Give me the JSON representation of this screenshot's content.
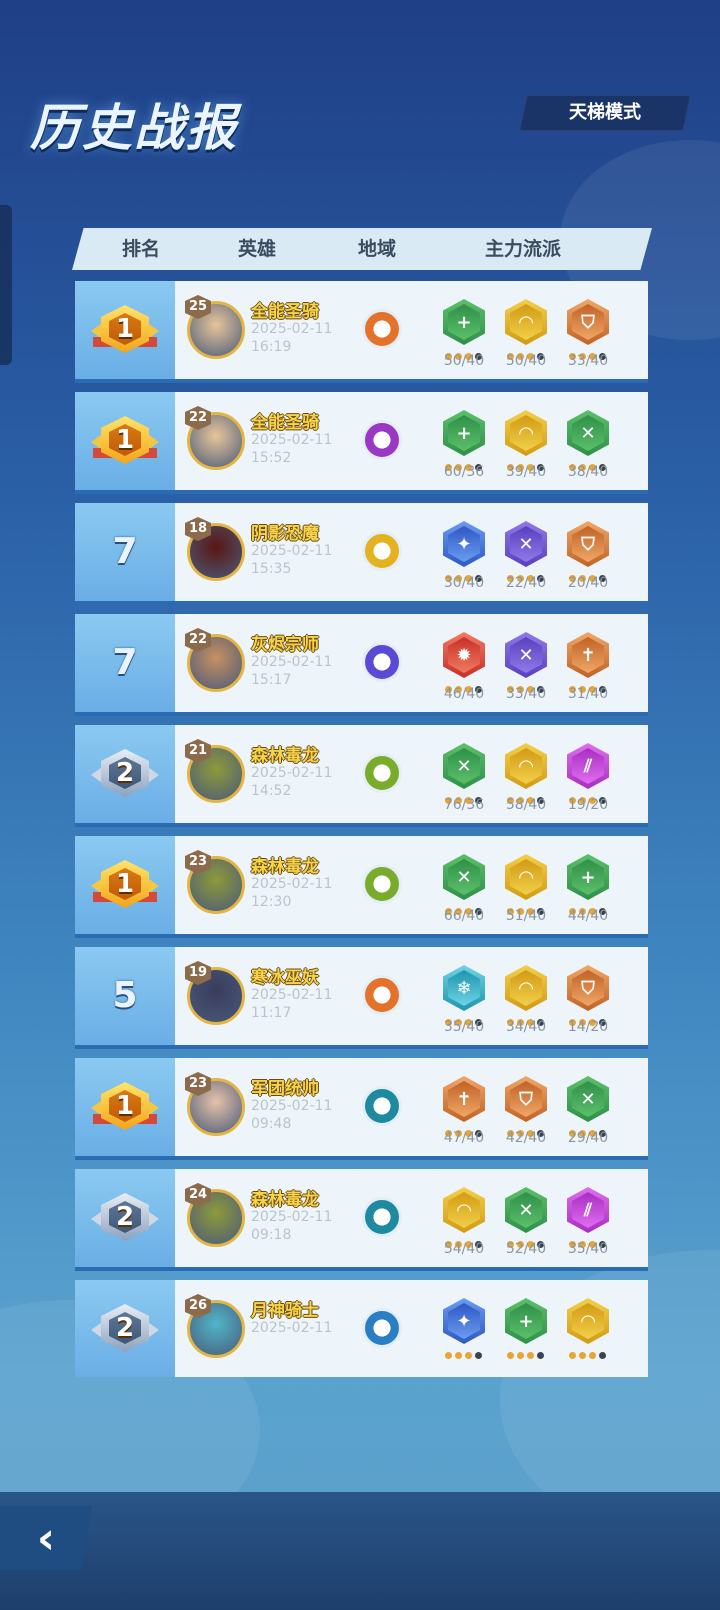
{
  "title": "历史战报",
  "mode_badge": "天梯模式",
  "columns": [
    "排名",
    "英雄",
    "地域",
    "主力流派"
  ],
  "colors": {
    "gold": "#f5d34a",
    "row_bg": "#eef5fa",
    "rank_bg": "#7cbcec",
    "green": "#3ea35a",
    "yellow": "#e6b521",
    "bronze": "#c8763a",
    "blue": "#3a6fd6",
    "purple": "#6c55c8",
    "red": "#d8463e",
    "magenta": "#c23ad0",
    "cyan": "#2ab0c4"
  },
  "matches": [
    {
      "rank": "1",
      "rank_style": "gold",
      "level": "25",
      "hero": "全能圣骑",
      "date": "2025-02-11",
      "time": "16:19",
      "region_icon": "axe-emblem-icon",
      "region_color": "#e4722a",
      "portrait_color": "#e7c69a",
      "stats": [
        {
          "icon": "plus-icon",
          "color": "green",
          "glyph": "+",
          "value": "50/40"
        },
        {
          "icon": "arm-icon",
          "color": "yellow",
          "glyph": "◠",
          "value": "50/40"
        },
        {
          "icon": "shield-icon",
          "color": "bronze",
          "glyph": "⛉",
          "value": "33/40"
        }
      ]
    },
    {
      "rank": "1",
      "rank_style": "gold",
      "level": "22",
      "hero": "全能圣骑",
      "date": "2025-02-11",
      "time": "15:52",
      "region_icon": "gears-icon",
      "region_color": "#9a37c4",
      "portrait_color": "#e7c69a",
      "stats": [
        {
          "icon": "plus-icon",
          "color": "green",
          "glyph": "+",
          "value": "60/36"
        },
        {
          "icon": "arm-icon",
          "color": "yellow",
          "glyph": "◠",
          "value": "39/40"
        },
        {
          "icon": "potion-icon",
          "color": "green",
          "glyph": "✕",
          "value": "38/40"
        }
      ]
    },
    {
      "rank": "7",
      "rank_style": "plain",
      "level": "18",
      "hero": "阴影恐魔",
      "date": "2025-02-11",
      "time": "15:35",
      "region_icon": "swirl-icon",
      "region_color": "#e4b21e",
      "portrait_color": "#5a1712",
      "stats": [
        {
          "icon": "sparkle-icon",
          "color": "blue",
          "glyph": "✦",
          "value": "30/40"
        },
        {
          "icon": "crossed-tools-icon",
          "color": "purple",
          "glyph": "✕",
          "value": "22/40"
        },
        {
          "icon": "shield-icon",
          "color": "bronze",
          "glyph": "⛉",
          "value": "20/40"
        }
      ]
    },
    {
      "rank": "7",
      "rank_style": "plain",
      "level": "22",
      "hero": "灰烬宗师",
      "date": "2025-02-11",
      "time": "15:17",
      "region_icon": "crest-icon",
      "region_color": "#5a4ad6",
      "portrait_color": "#c79060",
      "stats": [
        {
          "icon": "flame-icon",
          "color": "red",
          "glyph": "✹",
          "value": "46/40"
        },
        {
          "icon": "crossed-tools-icon",
          "color": "purple",
          "glyph": "✕",
          "value": "33/40"
        },
        {
          "icon": "sword-icon",
          "color": "bronze",
          "glyph": "✝",
          "value": "31/40"
        }
      ]
    },
    {
      "rank": "2",
      "rank_style": "silver",
      "level": "21",
      "hero": "森林毒龙",
      "date": "2025-02-11",
      "time": "14:52",
      "region_icon": "pentagram-icon",
      "region_color": "#7aac2c",
      "portrait_color": "#8e9a3a",
      "stats": [
        {
          "icon": "potion-icon",
          "color": "green",
          "glyph": "✕",
          "value": "76/36"
        },
        {
          "icon": "arm-icon",
          "color": "yellow",
          "glyph": "◠",
          "value": "58/40"
        },
        {
          "icon": "claw-icon",
          "color": "magenta",
          "glyph": "⫽",
          "value": "19/20"
        }
      ]
    },
    {
      "rank": "1",
      "rank_style": "gold",
      "level": "23",
      "hero": "森林毒龙",
      "date": "2025-02-11",
      "time": "12:30",
      "region_icon": "pentagram-icon",
      "region_color": "#7aac2c",
      "portrait_color": "#8e9a3a",
      "stats": [
        {
          "icon": "potion-icon",
          "color": "green",
          "glyph": "✕",
          "value": "66/40"
        },
        {
          "icon": "arm-icon",
          "color": "yellow",
          "glyph": "◠",
          "value": "51/40"
        },
        {
          "icon": "plus-icon",
          "color": "green",
          "glyph": "+",
          "value": "44/40"
        }
      ]
    },
    {
      "rank": "5",
      "rank_style": "plain",
      "level": "19",
      "hero": "寒冰巫妖",
      "date": "2025-02-11",
      "time": "11:17",
      "region_icon": "axe-emblem-icon",
      "region_color": "#e4722a",
      "portrait_color": "#3a3b5c",
      "stats": [
        {
          "icon": "snowflake-icon",
          "color": "cyan",
          "glyph": "❄",
          "value": "35/40"
        },
        {
          "icon": "arm-icon",
          "color": "yellow",
          "glyph": "◠",
          "value": "34/40"
        },
        {
          "icon": "shield-icon",
          "color": "bronze",
          "glyph": "⛉",
          "value": "14/20"
        }
      ]
    },
    {
      "rank": "1",
      "rank_style": "gold",
      "level": "23",
      "hero": "军团统帅",
      "date": "2025-02-11",
      "time": "09:48",
      "region_icon": "trident-icon",
      "region_color": "#1d8aa0",
      "portrait_color": "#e5c3a8",
      "stats": [
        {
          "icon": "sword-icon",
          "color": "bronze",
          "glyph": "✝",
          "value": "47/40"
        },
        {
          "icon": "shield-icon",
          "color": "bronze",
          "glyph": "⛉",
          "value": "42/40"
        },
        {
          "icon": "potion-icon",
          "color": "green",
          "glyph": "✕",
          "value": "29/40"
        }
      ]
    },
    {
      "rank": "2",
      "rank_style": "silver",
      "level": "24",
      "hero": "森林毒龙",
      "date": "2025-02-11",
      "time": "09:18",
      "region_icon": "trident-icon",
      "region_color": "#1d8aa0",
      "portrait_color": "#8e9a3a",
      "stats": [
        {
          "icon": "arm-icon",
          "color": "yellow",
          "glyph": "◠",
          "value": "54/40"
        },
        {
          "icon": "potion-icon",
          "color": "green",
          "glyph": "✕",
          "value": "52/40"
        },
        {
          "icon": "claw-icon",
          "color": "magenta",
          "glyph": "⫽",
          "value": "35/40"
        }
      ]
    },
    {
      "rank": "2",
      "rank_style": "silver",
      "level": "26",
      "hero": "月神骑士",
      "date": "2025-02-11",
      "time": "",
      "region_icon": "rune-icon",
      "region_color": "#2a7fc4",
      "portrait_color": "#4fb6c8",
      "stats": [
        {
          "icon": "sparkle-icon",
          "color": "blue",
          "glyph": "✦",
          "value": ""
        },
        {
          "icon": "plus-icon",
          "color": "green",
          "glyph": "+",
          "value": ""
        },
        {
          "icon": "arm-icon",
          "color": "yellow",
          "glyph": "◠",
          "value": ""
        }
      ]
    }
  ]
}
